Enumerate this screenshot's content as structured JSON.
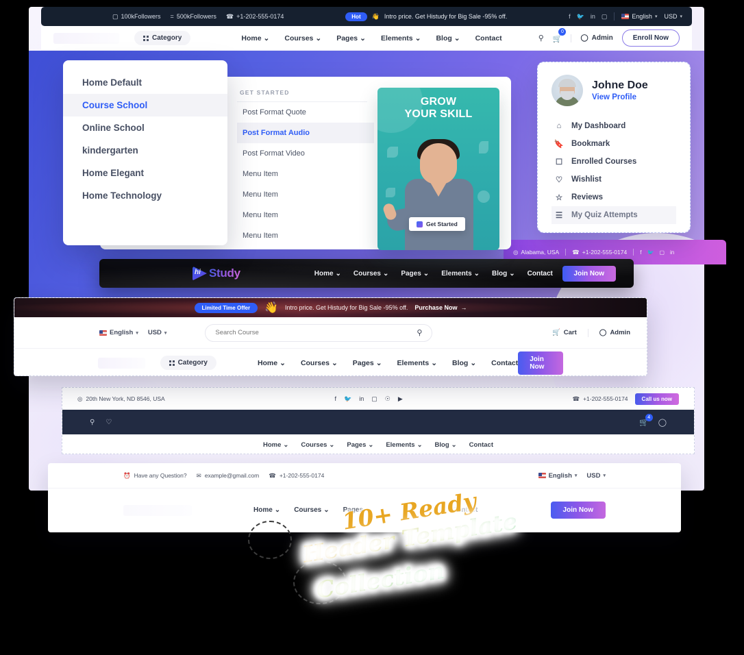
{
  "topbar": {
    "followers_instagram": "100kFollowers",
    "followers_facebook": "500kFollowers",
    "phone": "+1-202-555-0174",
    "hot_badge": "Hot",
    "promo": "Intro price. Get Histudy for Big Sale -95% off.",
    "language": "English",
    "currency": "USD"
  },
  "mainheader": {
    "category": "Category",
    "nav": [
      {
        "label": "Home",
        "caret": "⌄"
      },
      {
        "label": "Courses",
        "caret": "⌄"
      },
      {
        "label": "Pages",
        "caret": "⌄"
      },
      {
        "label": "Elements",
        "caret": "⌄"
      },
      {
        "label": "Blog",
        "caret": "⌄"
      },
      {
        "label": "Contact",
        "caret": ""
      }
    ],
    "cart_badge": "0",
    "admin": "Admin",
    "enroll": "Enroll Now"
  },
  "home_dropdown": {
    "items": [
      {
        "label": "Home Default",
        "active": false
      },
      {
        "label": "Course School",
        "active": true
      },
      {
        "label": "Online School",
        "active": false
      },
      {
        "label": "kindergarten",
        "active": false
      },
      {
        "label": "Home Elegant",
        "active": false
      },
      {
        "label": "Home Technology",
        "active": false
      }
    ]
  },
  "mega_menu": {
    "title": "GET STARTED",
    "items": [
      {
        "label": "Post Format Quote",
        "active": false
      },
      {
        "label": "Post Format Audio",
        "active": true
      },
      {
        "label": "Post Format Video",
        "active": false
      },
      {
        "label": "Menu Item",
        "active": false
      },
      {
        "label": "Menu Item",
        "active": false
      },
      {
        "label": "Menu Item",
        "active": false
      },
      {
        "label": "Menu Item",
        "active": false
      }
    ]
  },
  "promo_card": {
    "heading_line1": "GROW",
    "heading_line2": "YOUR SKILL",
    "button": "Get Started"
  },
  "profile_card": {
    "name": "Johne Doe",
    "view_profile": "View Profile",
    "items": [
      {
        "label": "My Dashboard",
        "icon": "home-icon"
      },
      {
        "label": "Bookmark",
        "icon": "bookmark-icon"
      },
      {
        "label": "Enrolled Courses",
        "icon": "bag-icon"
      },
      {
        "label": "Wishlist",
        "icon": "heart-icon"
      },
      {
        "label": "Reviews",
        "icon": "star-icon"
      },
      {
        "label": "My Quiz Attempts",
        "icon": "list-icon"
      }
    ]
  },
  "purple_strip": {
    "location": "Alabama, USA",
    "phone": "+1-202-555-0174"
  },
  "dark_header": {
    "logo_mark": "hi",
    "logo_text": "Study",
    "nav": [
      {
        "label": "Home",
        "caret": "⌄"
      },
      {
        "label": "Courses",
        "caret": "⌄"
      },
      {
        "label": "Pages",
        "caret": "⌄"
      },
      {
        "label": "Elements",
        "caret": "⌄"
      },
      {
        "label": "Blog",
        "caret": "⌄"
      },
      {
        "label": "Contact",
        "caret": ""
      }
    ],
    "join": "Join Now"
  },
  "search_header": {
    "badge": "Limited Time Offer",
    "promo": "Intro price. Get Histudy for Big Sale -95% off.",
    "purchase": "Purchase Now",
    "purchase_arrow": "→",
    "language": "English",
    "currency": "USD",
    "search_placeholder": "Search Course",
    "search_value": "",
    "cart": "Cart",
    "admin": "Admin",
    "category": "Category",
    "nav": [
      {
        "label": "Home",
        "caret": "⌄"
      },
      {
        "label": "Courses",
        "caret": "⌄"
      },
      {
        "label": "Pages",
        "caret": "⌄"
      },
      {
        "label": "Elements",
        "caret": "⌄"
      },
      {
        "label": "Blog",
        "caret": "⌄"
      },
      {
        "label": "Contact",
        "caret": ""
      }
    ],
    "join": "Join Now"
  },
  "navy_header": {
    "address": "20th New York, ND 8546, USA",
    "phone": "+1-202-555-0174",
    "call_button": "Call us now",
    "cart_badge": "4",
    "nav": [
      {
        "label": "Home",
        "caret": "⌄"
      },
      {
        "label": "Courses",
        "caret": "⌄"
      },
      {
        "label": "Pages",
        "caret": "⌄"
      },
      {
        "label": "Elements",
        "caret": "⌄"
      },
      {
        "label": "Blog",
        "caret": "⌄"
      },
      {
        "label": "Contact",
        "caret": ""
      }
    ]
  },
  "bottom_header": {
    "question": "Have any Question?",
    "email": "example@gmail.com",
    "phone": "+1-202-555-0174",
    "language": "English",
    "currency": "USD",
    "nav": [
      {
        "label": "Home",
        "caret": "⌄"
      },
      {
        "label": "Courses",
        "caret": "⌄"
      },
      {
        "label": "Pages",
        "caret": ""
      },
      {
        "label": "Contact",
        "caret": ""
      }
    ],
    "join": "Join Now"
  },
  "handwriting": {
    "line1": "10+ Ready",
    "line2": "Header Template",
    "line3": "Collection"
  },
  "colors": {
    "accent_blue": "#2f5df6",
    "gradient_start": "#4a5cf0",
    "gradient_end": "#c468df",
    "dark_navy": "#222b42",
    "topbar_dark": "#16202f"
  }
}
